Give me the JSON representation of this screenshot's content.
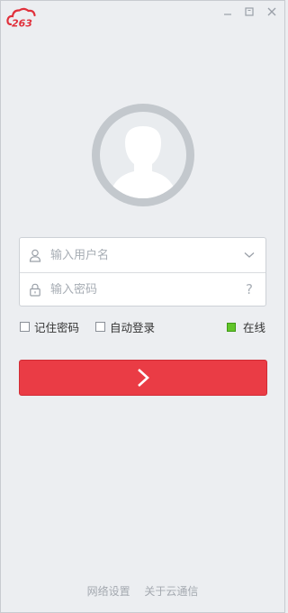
{
  "app": {
    "logo_text": "263"
  },
  "window_controls": [
    "minimize-icon",
    "maximize-icon",
    "close-icon"
  ],
  "login": {
    "username_placeholder": "输入用户名",
    "password_placeholder": "输入密码",
    "help_mark": "?"
  },
  "options": {
    "remember_password": "记住密码",
    "auto_login": "自动登录",
    "status_label": "在线"
  },
  "footer": {
    "network_settings": "网络设置",
    "about": "关于云通信"
  },
  "colors": {
    "accent": "#ea3c45",
    "online": "#62c52a",
    "background": "#eceef1"
  }
}
